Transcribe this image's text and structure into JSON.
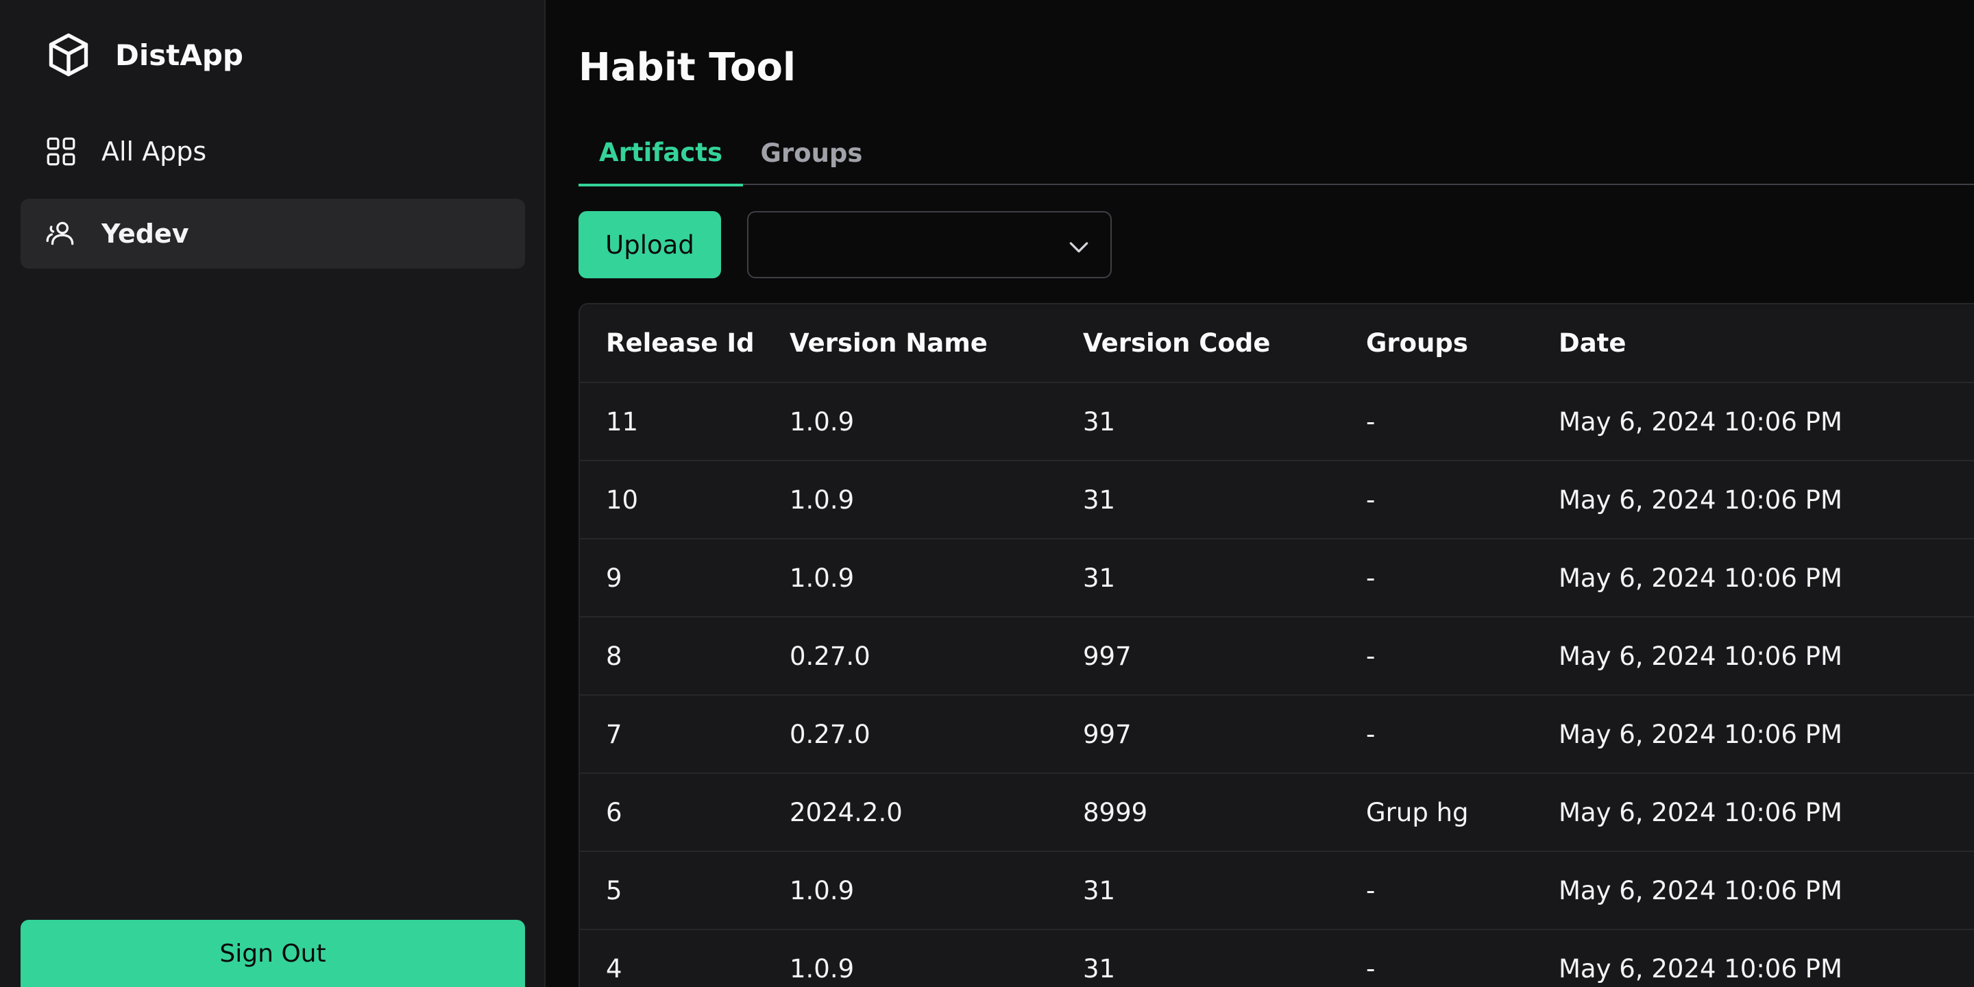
{
  "sidebar": {
    "brand": {
      "name": "DistApp",
      "icon": "cube-icon"
    },
    "items": [
      {
        "label": "All Apps",
        "icon": "grid-icon",
        "active": false
      },
      {
        "label": "Yedev",
        "icon": "users-icon",
        "active": true
      }
    ],
    "sign_out_label": "Sign Out"
  },
  "main": {
    "title": "Habit Tool",
    "tabs": [
      {
        "label": "Artifacts",
        "active": true
      },
      {
        "label": "Groups",
        "active": false
      }
    ],
    "toolbar": {
      "upload_label": "Upload",
      "filter_select_value": "",
      "filter_select_icon": "chevron-down-icon"
    },
    "table": {
      "columns": [
        "Release Id",
        "Version Name",
        "Version Code",
        "Groups",
        "Date"
      ],
      "rows": [
        [
          "11",
          "1.0.9",
          "31",
          "-",
          "May 6, 2024 10:06 PM"
        ],
        [
          "10",
          "1.0.9",
          "31",
          "-",
          "May 6, 2024 10:06 PM"
        ],
        [
          "9",
          "1.0.9",
          "31",
          "-",
          "May 6, 2024 10:06 PM"
        ],
        [
          "8",
          "0.27.0",
          "997",
          "-",
          "May 6, 2024 10:06 PM"
        ],
        [
          "7",
          "0.27.0",
          "997",
          "-",
          "May 6, 2024 10:06 PM"
        ],
        [
          "6",
          "2024.2.0",
          "8999",
          "Grup hg",
          "May 6, 2024 10:06 PM"
        ],
        [
          "5",
          "1.0.9",
          "31",
          "-",
          "May 6, 2024 10:06 PM"
        ],
        [
          "4",
          "1.0.9",
          "31",
          "-",
          "May 6, 2024 10:06 PM"
        ]
      ]
    }
  },
  "colors": {
    "accent": "#34d399",
    "sidebar_bg": "#18181b",
    "main_bg": "#0a0a0b",
    "active_item_bg": "#27272a"
  }
}
